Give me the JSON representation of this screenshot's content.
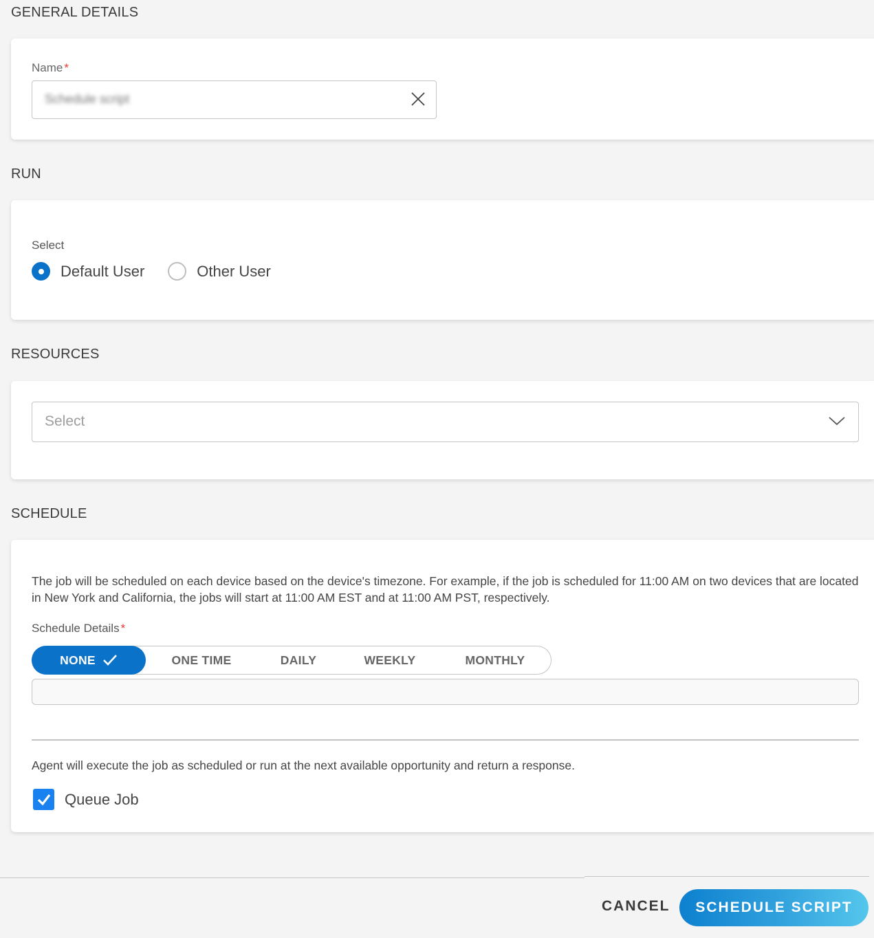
{
  "general_details": {
    "title": "GENERAL DETAILS",
    "name_label": "Name",
    "required_mark": "*",
    "name_value": "Schedule script",
    "clear_icon": "close-icon"
  },
  "run": {
    "title": "RUN",
    "select_label": "Select",
    "options": [
      {
        "label": "Default User",
        "selected": true
      },
      {
        "label": "Other User",
        "selected": false
      }
    ]
  },
  "resources": {
    "title": "RESOURCES",
    "placeholder": "Select",
    "dropdown_icon": "chevron-down-icon"
  },
  "schedule": {
    "title": "SCHEDULE",
    "info_text": "The job will be scheduled on each device based on the device's timezone. For example, if the job is scheduled for 11:00 AM on two devices that are located in New York and California, the jobs will start at 11:00 AM EST and at 11:00 AM PST, respectively.",
    "details_label": "Schedule Details",
    "required_mark": "*",
    "options": [
      {
        "label": "NONE",
        "active": true
      },
      {
        "label": "ONE TIME",
        "active": false
      },
      {
        "label": "DAILY",
        "active": false
      },
      {
        "label": "WEEKLY",
        "active": false
      },
      {
        "label": "MONTHLY",
        "active": false
      }
    ],
    "details_value": "",
    "agent_text": "Agent will execute the job as scheduled or run at the next available opportunity and return a response.",
    "queue_job_label": "Queue Job",
    "queue_job_checked": true
  },
  "footer": {
    "cancel_label": "CANCEL",
    "submit_label": "SCHEDULE SCRIPT"
  },
  "colors": {
    "accent": "#0b72c9",
    "checkbox": "#1a82f0",
    "required": "#e53935",
    "background": "#f4f4f4"
  }
}
